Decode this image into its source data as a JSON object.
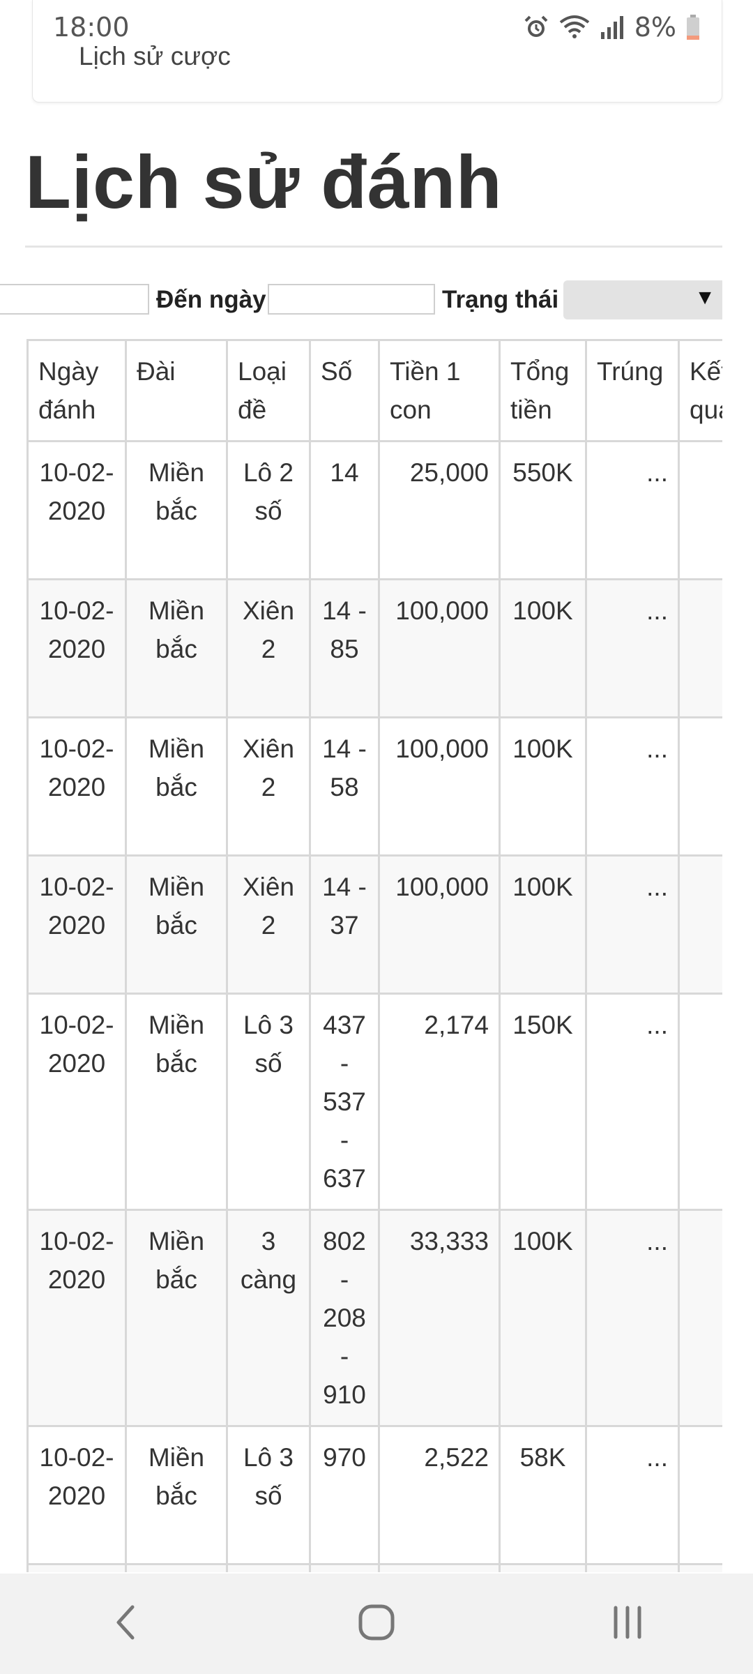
{
  "status": {
    "time": "18:00",
    "battery": "8%",
    "icons": [
      "alarm-icon",
      "wifi-icon",
      "signal-icon",
      "battery-icon"
    ]
  },
  "top_card": {
    "link": "Lịch sử cược"
  },
  "page": {
    "title": "Lịch sử đánh"
  },
  "filters": {
    "from_date_value": "",
    "to_date_label": "Đến ngày",
    "to_date_value": "",
    "status_label": "Trạng thái",
    "status_selected": ""
  },
  "table": {
    "headers": [
      "Ngày đánh",
      "Đài",
      "Loại đề",
      "Số",
      "Tiền 1 con",
      "Tổng tiền",
      "Trúng",
      "Kết quả"
    ],
    "rows": [
      {
        "date": "10-02-2020",
        "station": "Miền bắc",
        "type": "Lô 2 số",
        "number": "14",
        "per_unit": "25,000",
        "total": "550K",
        "win": "...",
        "result": ""
      },
      {
        "date": "10-02-2020",
        "station": "Miền bắc",
        "type": "Xiên 2",
        "number": "14 - 85",
        "per_unit": "100,000",
        "total": "100K",
        "win": "...",
        "result": ""
      },
      {
        "date": "10-02-2020",
        "station": "Miền bắc",
        "type": "Xiên 2",
        "number": "14 - 58",
        "per_unit": "100,000",
        "total": "100K",
        "win": "...",
        "result": ""
      },
      {
        "date": "10-02-2020",
        "station": "Miền bắc",
        "type": "Xiên 2",
        "number": "14 - 37",
        "per_unit": "100,000",
        "total": "100K",
        "win": "...",
        "result": ""
      },
      {
        "date": "10-02-2020",
        "station": "Miền bắc",
        "type": "Lô 3 số",
        "number": "437 - 537 - 637",
        "per_unit": "2,174",
        "total": "150K",
        "win": "...",
        "result": ""
      },
      {
        "date": "10-02-2020",
        "station": "Miền bắc",
        "type": "3 càng",
        "number": "802 - 208 - 910",
        "per_unit": "33,333",
        "total": "100K",
        "win": "...",
        "result": ""
      },
      {
        "date": "10-02-2020",
        "station": "Miền bắc",
        "type": "Lô 3 số",
        "number": "970",
        "per_unit": "2,522",
        "total": "58K",
        "win": "...",
        "result": ""
      },
      {
        "date": "",
        "station": "",
        "type": "",
        "number": "",
        "per_unit": "",
        "total": "",
        "win": "",
        "result": ""
      }
    ]
  },
  "nav": {
    "icons": [
      "back-icon",
      "home-icon",
      "recents-icon"
    ]
  }
}
